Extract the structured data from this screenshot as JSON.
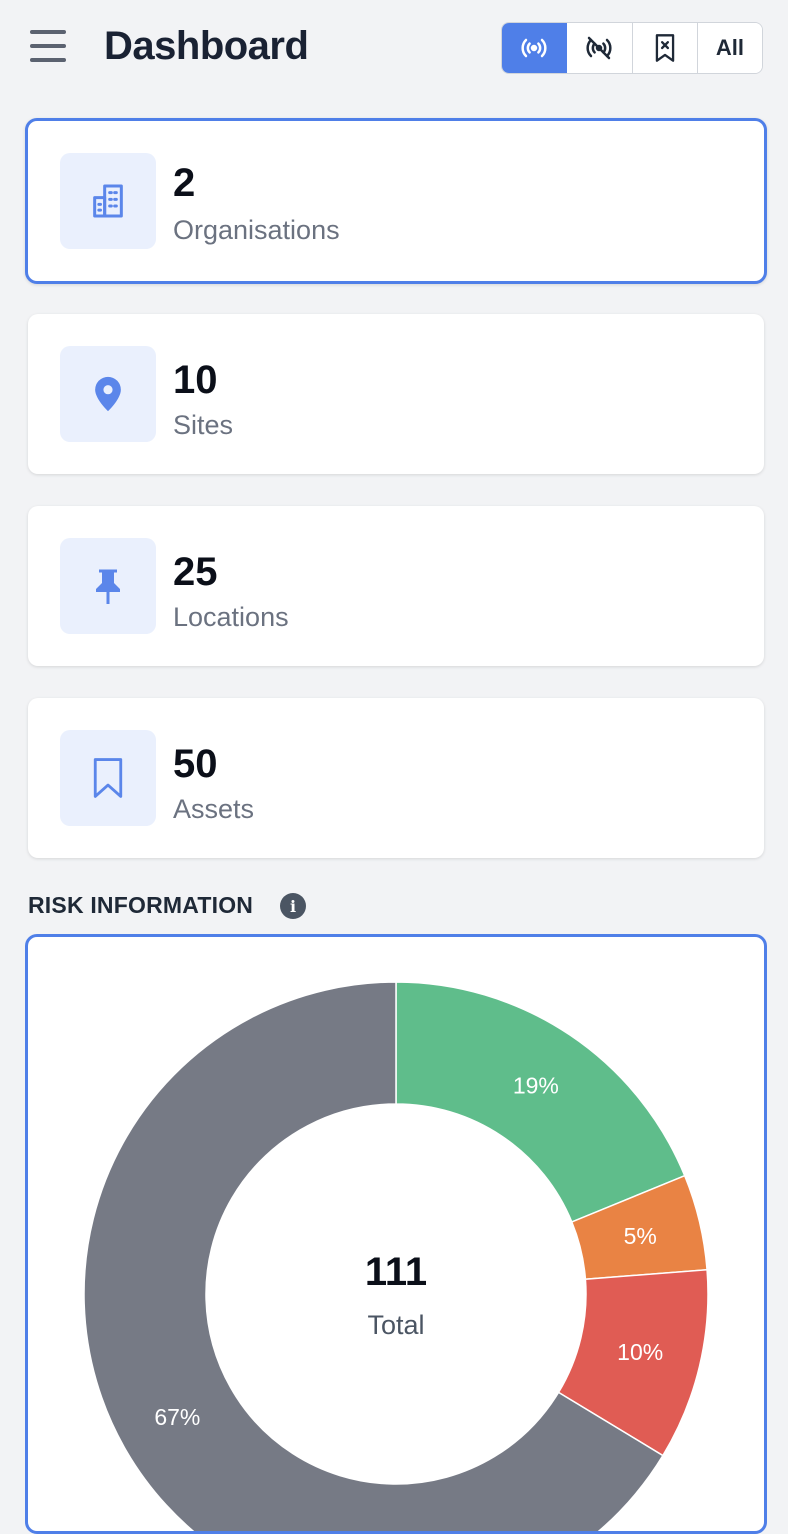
{
  "header": {
    "title": "Dashboard",
    "filters": [
      {
        "icon": "broadcast-icon",
        "active": true
      },
      {
        "icon": "broadcast-off-icon",
        "active": false
      },
      {
        "icon": "bookmark-x-icon",
        "active": false
      },
      {
        "label": "All",
        "active": false
      }
    ]
  },
  "cards": [
    {
      "count": "2",
      "label": "Organisations",
      "icon": "building-icon",
      "selected": true
    },
    {
      "count": "10",
      "label": "Sites",
      "icon": "map-pin-icon",
      "selected": false
    },
    {
      "count": "25",
      "label": "Locations",
      "icon": "pushpin-icon",
      "selected": false
    },
    {
      "count": "50",
      "label": "Assets",
      "icon": "bookmark-icon",
      "selected": false
    }
  ],
  "risk": {
    "heading": "RISK INFORMATION",
    "info_icon": "i",
    "total_value": "111",
    "total_label": "Total"
  },
  "colors": {
    "accent": "#4f7fe8",
    "green": "#5fbd8b",
    "orange": "#e98344",
    "red": "#e05c54",
    "gray": "#767a85"
  },
  "chart_data": {
    "type": "pie",
    "donut": true,
    "slices": [
      {
        "label": "19%",
        "value": 19,
        "color": "#5fbd8b"
      },
      {
        "label": "5%",
        "value": 5,
        "color": "#e98344"
      },
      {
        "label": "10%",
        "value": 10,
        "color": "#e05c54"
      },
      {
        "label": "67%",
        "value": 67,
        "color": "#767a85"
      }
    ],
    "center_value": "111",
    "center_label": "Total"
  }
}
